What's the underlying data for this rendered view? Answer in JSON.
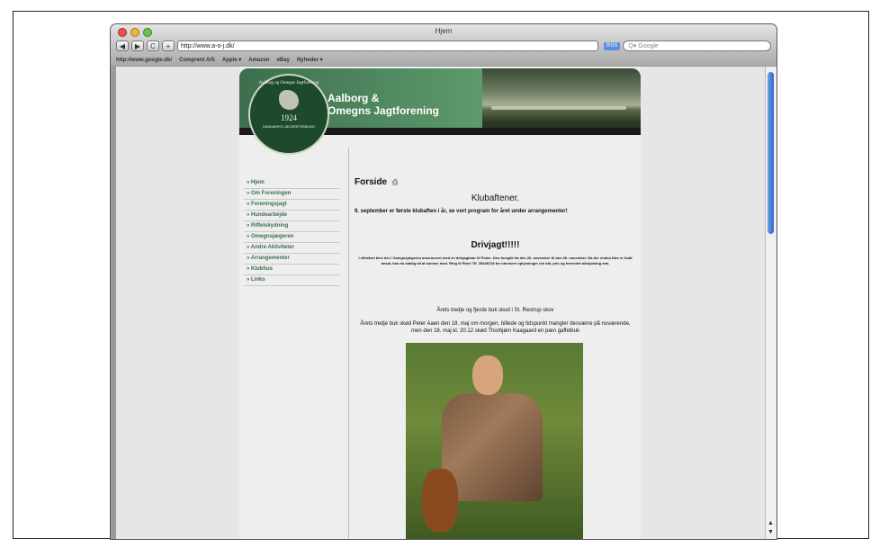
{
  "window": {
    "title": "Hjem"
  },
  "toolbar": {
    "back": "◀",
    "forward": "▶",
    "reload": "C",
    "add": "+",
    "url": "http://www.a-o-j.dk/",
    "rss": "RSS",
    "search_placeholder": "Q▾ Google"
  },
  "bookmarks": [
    "http://www.google.dk/",
    "Comprent A/S",
    "Apple ▾",
    "Amazon",
    "eBay",
    "Nyheder ▾"
  ],
  "site": {
    "name_line1": "Aalborg &",
    "name_line2": "Omegns Jagtforening",
    "emblem_top": "Aalborg og Omegns Jagtforening",
    "emblem_year": "1924",
    "emblem_ring": "DANMARKS JÆGERFORBUND"
  },
  "nav": [
    "» Hjem",
    "» Om Foreningen",
    "» Foreningsjagt",
    "» Hundearbejde",
    "» Riffelskydning",
    "» Omegnsjægeren",
    "» Andre Aktiviteter",
    "» Arrangementer",
    "» Klubhus",
    "» Links"
  ],
  "content": {
    "heading": "Forside",
    "print_icon": "⎙",
    "klub_title": "Klubaftener.",
    "klub_text": "9. september er første klubaften i år, se vort program for året under arrangementer!",
    "driv_title": "Drivjagt!!!!!",
    "driv_text": "I efteråret blev der i Omegnsjægeren annonceret med en drivjagtstur til Polen. Den foregår fra den 26. november til den 30. november. Da der endnu ikke er fuldt besat, kan du stadig nå at komme med. Ring til René Tlf. 25438728 for nærmere oplysninger om bla. pris og forventet afskydning mm.",
    "buk_title": "Årets tredje og fjerde buk skud i St. Restrup skov",
    "buk_text": "Årets tredje buk skød Peter Aaen den 18. maj om morgen, billede og tidspunkt mangler desværre på nuværende, men den 18. maj kl. 20.12 skød Thorbjørn Kaagaard en pæn gaffelbuk"
  }
}
